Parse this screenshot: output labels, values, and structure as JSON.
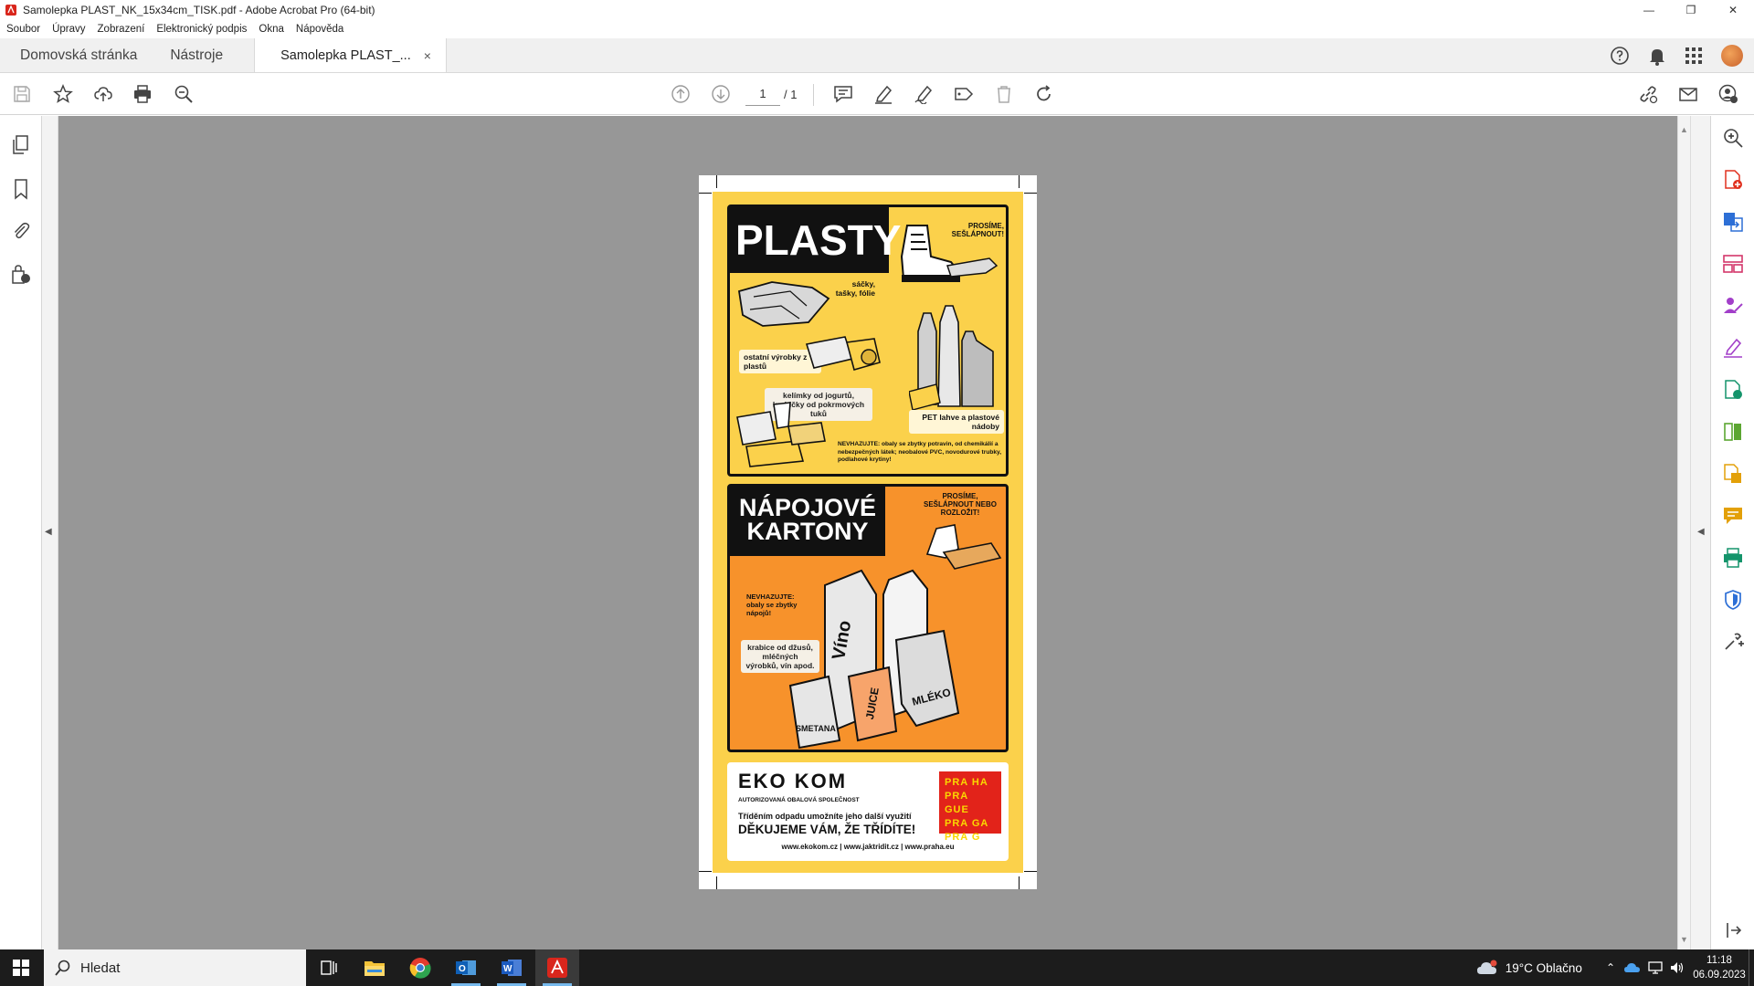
{
  "window": {
    "title": "Samolepka PLAST_NK_15x34cm_TISK.pdf - Adobe Acrobat Pro (64-bit)",
    "minimize": "—",
    "maximize": "❐",
    "close": "✕"
  },
  "menu": [
    "Soubor",
    "Úpravy",
    "Zobrazení",
    "Elektronický podpis",
    "Okna",
    "Nápověda"
  ],
  "tabs": {
    "home": "Domovská stránka",
    "tools": "Nástroje",
    "document": "Samolepka PLAST_...",
    "close": "×"
  },
  "toolbar": {
    "page_current": "1",
    "page_total": "/ 1"
  },
  "document": {
    "panel1": {
      "title": "PLASTY",
      "stamp": "PROSÍME, SEŠLÁPNOUT!",
      "item1": "sáčky, tašky, fólie",
      "item2": "ostatní výrobky z plastů",
      "item3": "kelímky od jogurtů, krabičky od pokrmových tuků",
      "item4": "PET lahve a plastové nádoby",
      "warning": "NEVHAZUJTE: obaly se zbytky potravin, od chemikálií a nebezpečných látek; neobalové PVC, novodurové trubky, podlahové krytiny!"
    },
    "panel2": {
      "title_line1": "NÁPOJOVÉ",
      "title_line2": "KARTONY",
      "stamp": "PROSÍME, SEŠLÁPNOUT NEBO ROZLOŽIT!",
      "warning": "NEVHAZUJTE: obaly se zbytky nápojů!",
      "item1": "krabice od džusů, mléčných výrobků, vín apod.",
      "carton_labels": [
        "Víno",
        "SMETANA",
        "JUICE",
        "MLÉKO"
      ]
    },
    "panel3": {
      "brand": "EKO KOM",
      "brand_sub": "AUTORIZOVANÁ OBALOVÁ SPOLEČNOST",
      "line1": "Tříděním odpadu umožníte jeho další využití",
      "line2": "DĚKUJEME VÁM, ŽE TŘÍDÍTE!",
      "urls": "www.ekokom.cz | www.jaktridit.cz | www.praha.eu",
      "praha_logo": [
        "PRA HA",
        "PRA GUE",
        "PRA GA",
        "PRA G"
      ]
    }
  },
  "taskbar": {
    "search_placeholder": "Hledat",
    "weather": "19°C  Oblačno",
    "time": "11:18",
    "date": "06.09.2023"
  },
  "colors": {
    "yellow": "#fbd14b",
    "orange": "#f7922b",
    "praha_red": "#e2231a",
    "doc_bg": "#979797"
  }
}
